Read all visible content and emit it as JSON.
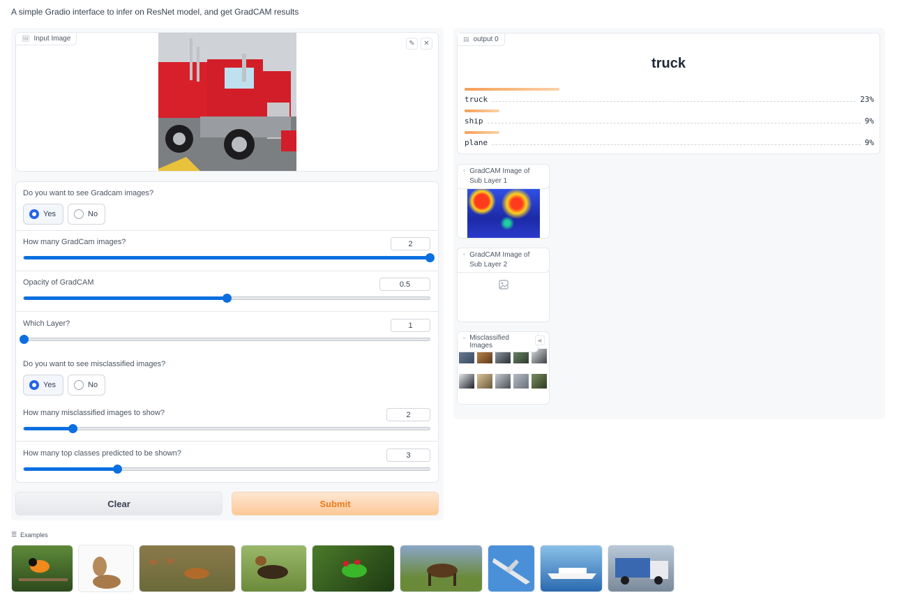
{
  "description": "A simple Gradio interface to infer on ResNet model, and get GradCAM results",
  "input_image": {
    "label": "Input Image",
    "icon": "image-icon",
    "actions": [
      {
        "name": "edit-icon",
        "glyph": "✎"
      },
      {
        "name": "close-icon",
        "glyph": "✕"
      }
    ]
  },
  "gradcam_toggle": {
    "question": "Do you want to see Gradcam images?",
    "options": [
      "Yes",
      "No"
    ],
    "selected": "Yes"
  },
  "gradcam_count": {
    "label": "How many GradCam images?",
    "value": "2",
    "fraction": 1.0
  },
  "opacity": {
    "label": "Opacity of GradCAM",
    "value": "0.5",
    "fraction": 0.5
  },
  "layer": {
    "label": "Which Layer?",
    "value": "1",
    "fraction": 0.0
  },
  "misclassified_toggle": {
    "question": "Do you want to see misclassified images?",
    "options": [
      "Yes",
      "No"
    ],
    "selected": "Yes"
  },
  "misclassified_count": {
    "label": "How many misclassified images to show?",
    "value": "2",
    "fraction": 0.12
  },
  "top_classes": {
    "label": "How many top classes predicted to be shown?",
    "value": "3",
    "fraction": 0.23
  },
  "buttons": {
    "clear": "Clear",
    "submit": "Submit"
  },
  "output": {
    "label": "output 0",
    "top_class": "truck",
    "confidences": [
      {
        "label": "truck",
        "value": "23%",
        "fraction": 0.23
      },
      {
        "label": "ship",
        "value": "9%",
        "fraction": 0.085
      },
      {
        "label": "plane",
        "value": "9%",
        "fraction": 0.085
      }
    ]
  },
  "gradcam_1": {
    "label": "GradCAM Image of Sub Layer 1"
  },
  "gradcam_2": {
    "label": "GradCAM Image of Sub Layer 2"
  },
  "misclassified": {
    "label": "Misclassified Images"
  },
  "examples": {
    "label": "Examples",
    "items": [
      "bird",
      "cat",
      "deer",
      "dog",
      "frog",
      "horse",
      "plane",
      "ship",
      "truck"
    ]
  }
}
